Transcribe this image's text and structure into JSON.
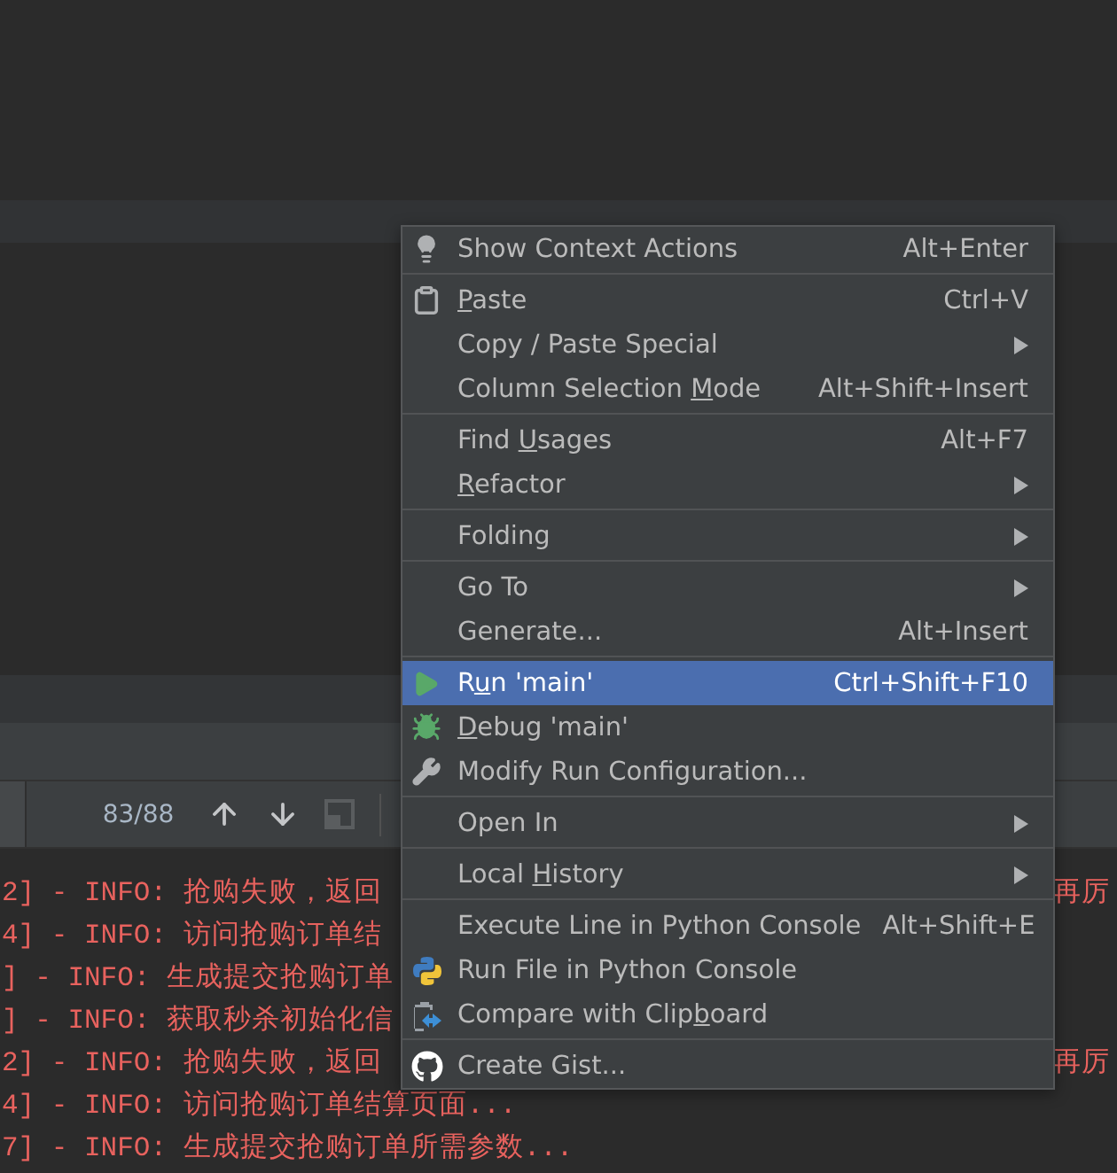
{
  "console_toolbar": {
    "match_count": "83/88"
  },
  "console": {
    "lines": [
      {
        "text": "2] - INFO: 抢购失败，返回",
        "right_text": "再厉"
      },
      {
        "text": "4] - INFO: 访问抢购订单结"
      },
      {
        "text": "] - INFO: 生成提交抢购订单"
      },
      {
        "text": "] - INFO: 获取秒杀初始化信"
      },
      {
        "text": "2] - INFO: 抢购失败，返回",
        "right_text": "再厉"
      },
      {
        "text": "4] - INFO: 访问抢购订单结算页面..."
      },
      {
        "text": "7] - INFO: 生成提交抢购订单所需参数..."
      }
    ]
  },
  "context_menu": {
    "groups": [
      {
        "items": [
          {
            "label": "Show Context Actions",
            "shortcut": "Alt+Enter",
            "selected": false
          }
        ]
      },
      {
        "items": [
          {
            "label": [
              {
                "text": "P",
                "underlined": true
              },
              {
                "text": "aste"
              }
            ],
            "shortcut": "Ctrl+V",
            "selected": false
          },
          {
            "label": "Copy / Paste Special",
            "submenu": true,
            "selected": false
          },
          {
            "label": [
              {
                "text": "Column Selection "
              },
              {
                "text": "M",
                "underlined": true
              },
              {
                "text": "ode"
              }
            ],
            "shortcut": "Alt+Shift+Insert",
            "selected": false
          }
        ]
      },
      {
        "items": [
          {
            "label": [
              {
                "text": "Find "
              },
              {
                "text": "U",
                "underlined": true
              },
              {
                "text": "sages"
              }
            ],
            "shortcut": "Alt+F7",
            "selected": false
          },
          {
            "label": [
              {
                "text": "R",
                "underlined": true
              },
              {
                "text": "efactor"
              }
            ],
            "submenu": true,
            "selected": false
          }
        ]
      },
      {
        "items": [
          {
            "label": "Folding",
            "submenu": true,
            "selected": false
          }
        ]
      },
      {
        "items": [
          {
            "label": "Go To",
            "submenu": true,
            "selected": false
          },
          {
            "label": "Generate...",
            "shortcut": "Alt+Insert",
            "selected": false
          }
        ]
      },
      {
        "items": [
          {
            "label": [
              {
                "text": "R"
              },
              {
                "text": "u",
                "underlined": true
              },
              {
                "text": "n 'main'"
              }
            ],
            "shortcut": "Ctrl+Shift+F10",
            "selected": true
          },
          {
            "label": [
              {
                "text": "D",
                "underlined": true
              },
              {
                "text": "ebug 'main'"
              }
            ],
            "selected": false
          },
          {
            "label": "Modify Run Configuration...",
            "selected": false
          }
        ]
      },
      {
        "items": [
          {
            "label": "Open In",
            "submenu": true,
            "selected": false
          }
        ]
      },
      {
        "items": [
          {
            "label": [
              {
                "text": "Local "
              },
              {
                "text": "H",
                "underlined": true
              },
              {
                "text": "istory"
              }
            ],
            "submenu": true,
            "selected": false
          }
        ]
      },
      {
        "items": [
          {
            "label": "Execute Line in Python Console",
            "shortcut": "Alt+Shift+E",
            "selected": false
          },
          {
            "label": "Run File in Python Console",
            "selected": false
          },
          {
            "label": [
              {
                "text": "Compare with Clip"
              },
              {
                "text": "b",
                "underlined": true
              },
              {
                "text": "oard"
              }
            ],
            "selected": false
          }
        ]
      },
      {
        "items": [
          {
            "label": "Create Gist...",
            "selected": false
          }
        ]
      }
    ]
  }
}
